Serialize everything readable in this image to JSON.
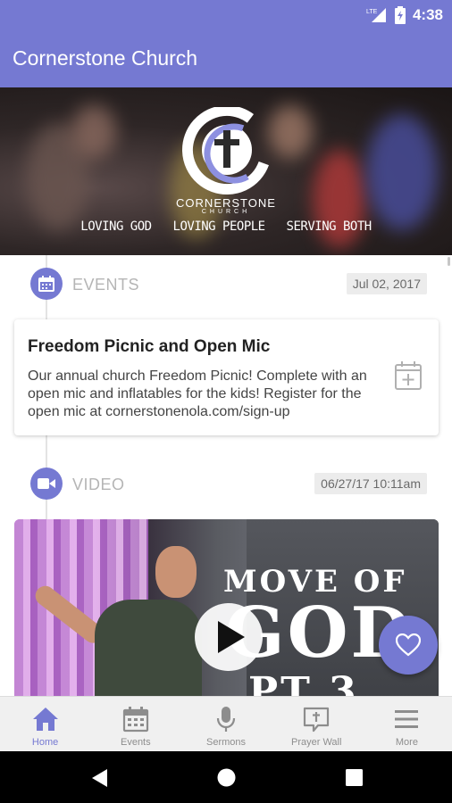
{
  "status_bar": {
    "time": "4:38",
    "network": "LTE"
  },
  "app_bar": {
    "title": "Cornerstone Church"
  },
  "hero": {
    "brand": "CORNERSTONE",
    "brand_sub": "CHURCH",
    "taglines": [
      "LOVING GOD",
      "LOVING PEOPLE",
      "SERVING BOTH"
    ]
  },
  "feed": {
    "events": {
      "label": "EVENTS",
      "date": "Jul 02, 2017",
      "icon": "calendar-icon",
      "card": {
        "title": "Freedom Picnic and Open Mic",
        "description": "Our annual church Freedom Picnic! Complete with an open mic and inflatables for the kids! Register for the open mic at cornerstonenola.com/sign-up",
        "action_icon": "calendar-add-icon"
      }
    },
    "video": {
      "label": "VIDEO",
      "date": "06/27/17 10:11am",
      "icon": "video-camera-icon",
      "thumbnail_text": [
        "MOVE OF",
        "GOD",
        "PT 3"
      ]
    }
  },
  "fab": {
    "icon": "heart-icon"
  },
  "bottom_nav": {
    "items": [
      {
        "label": "Home",
        "icon": "home-icon",
        "active": true
      },
      {
        "label": "Events",
        "icon": "calendar-icon",
        "active": false
      },
      {
        "label": "Sermons",
        "icon": "microphone-icon",
        "active": false
      },
      {
        "label": "Prayer Wall",
        "icon": "prayer-wall-icon",
        "active": false
      },
      {
        "label": "More",
        "icon": "menu-icon",
        "active": false
      }
    ]
  },
  "colors": {
    "primary": "#7579d2",
    "nav_bg": "#f0f0f0",
    "label_gray": "#b5b5b5"
  }
}
